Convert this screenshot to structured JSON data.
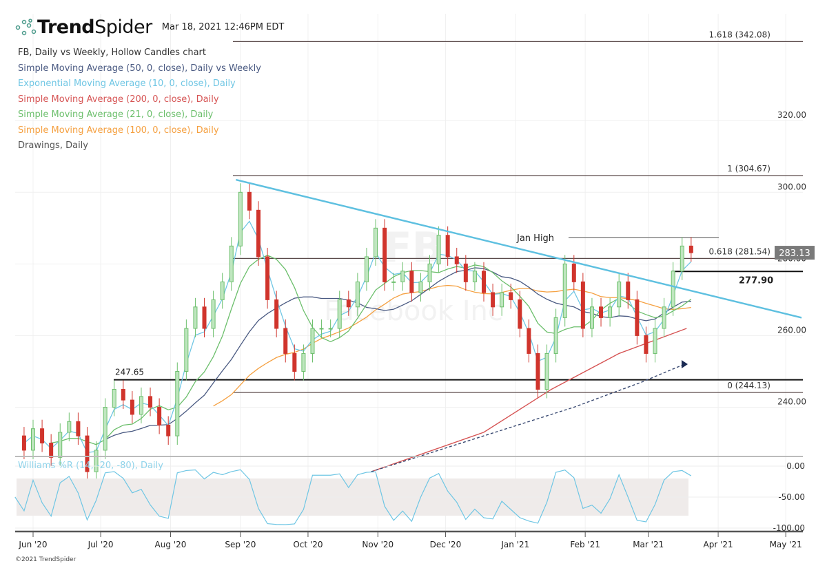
{
  "header": {
    "brand_bold": "Trend",
    "brand_light": "Spider",
    "timestamp": "Mar 18, 2021 12:46PM EDT"
  },
  "legend": [
    {
      "text": "FB, Daily vs Weekly, Hollow Candles chart",
      "color": "#333333"
    },
    {
      "text": "Simple Moving Average (50, 0, close), Daily vs Weekly",
      "color": "#4a5a82"
    },
    {
      "text": "Exponential Moving Average (10, 0, close), Daily",
      "color": "#6fc6e4"
    },
    {
      "text": "Simple Moving Average (200, 0, close), Daily",
      "color": "#d65454"
    },
    {
      "text": "Simple Moving Average (21, 0, close), Daily",
      "color": "#6cbf6c"
    },
    {
      "text": "Simple Moving Average (100, 0, close), Daily",
      "color": "#f5a040"
    },
    {
      "text": "Drawings, Daily",
      "color": "#555555"
    }
  ],
  "watermark": {
    "symbol": "FB",
    "name": "Facebook Inc"
  },
  "copyright": "©2021 TrendSpider",
  "chart_data": {
    "type": "candlestick",
    "symbol": "FB",
    "price_axis": {
      "ticks": [
        "240.00",
        "260.00",
        "280.00",
        "300.00",
        "320.00"
      ],
      "tick_values": [
        240,
        260,
        280,
        300,
        320
      ],
      "range": [
        225,
        345
      ]
    },
    "x_axis": {
      "labels": [
        "Jun '20",
        "Jul '20",
        "Aug '20",
        "Sep '20",
        "Oct '20",
        "Nov '20",
        "Dec '20",
        "Jan '21",
        "Feb '21",
        "Mar '21",
        "Apr '21",
        "May '21"
      ],
      "day_offsets_from_jun1": [
        0,
        30,
        61,
        92,
        122,
        153,
        183,
        214,
        245,
        273,
        304,
        334
      ]
    },
    "close_step_days": 4,
    "close_start_day": -8,
    "closes": [
      232,
      228,
      234,
      230,
      226,
      233,
      236,
      232,
      222,
      228,
      240,
      245,
      242,
      238,
      243,
      240,
      235,
      232,
      250,
      262,
      268,
      262,
      270,
      275,
      285,
      300,
      295,
      282,
      270,
      262,
      255,
      250,
      255,
      262,
      262,
      262,
      270,
      268,
      275,
      282,
      290,
      275,
      275,
      278,
      272,
      275,
      280,
      288,
      282,
      280,
      275,
      278,
      272,
      268,
      272,
      270,
      262,
      255,
      245,
      255,
      265,
      280,
      275,
      262,
      268,
      265,
      268,
      275,
      270,
      260,
      255,
      262,
      268,
      278,
      285,
      283.13
    ],
    "last_price": "283.13",
    "sma200_points": [
      [
        150,
        222
      ],
      [
        200,
        233
      ],
      [
        230,
        245
      ],
      [
        260,
        255
      ],
      [
        290,
        262
      ]
    ],
    "sma50_weekly_points": [
      [
        150,
        222
      ],
      [
        200,
        232
      ],
      [
        240,
        240
      ],
      [
        270,
        247
      ],
      [
        289,
        252
      ]
    ],
    "levels": [
      {
        "label": "1.618 (342.08)",
        "value": 342.08
      },
      {
        "label": "1 (304.67)",
        "value": 304.67
      },
      {
        "label": "0.618 (281.54)",
        "value": 281.54
      },
      {
        "label": "0 (244.13)",
        "value": 244.13
      },
      {
        "label": "247.65",
        "value": 247.65
      },
      {
        "label": "277.90",
        "value": 277.9
      },
      {
        "label": "Jan High",
        "value": 287.4
      }
    ],
    "trendline": {
      "from": [
        90,
        303.5
      ],
      "to": [
        341,
        265
      ]
    },
    "indicator": {
      "title": "Williams %R (14, -20, -80), Daily",
      "ticks": [
        "0.00",
        "-50.00",
        "-100.00"
      ],
      "tick_values": [
        0,
        -50,
        -100
      ],
      "band": [
        -20,
        -80
      ],
      "range": [
        -100,
        0
      ]
    }
  }
}
